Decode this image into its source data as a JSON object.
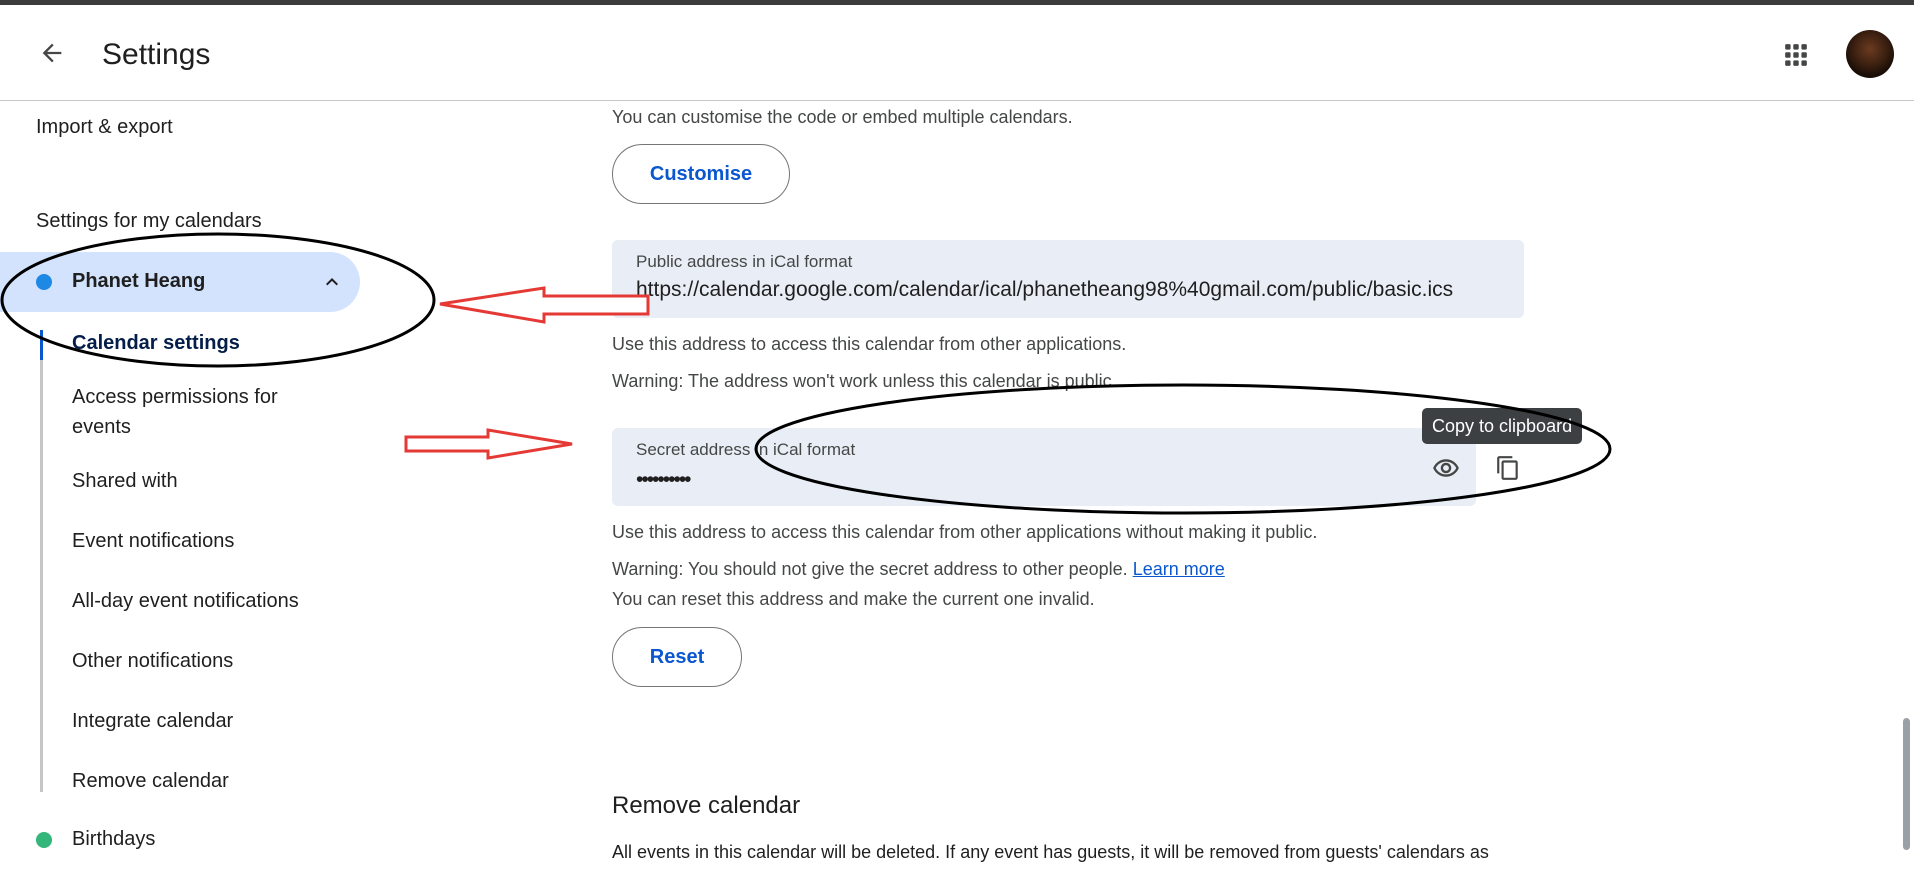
{
  "header": {
    "title": "Settings",
    "back_icon": "arrow-back-icon",
    "apps_icon": "apps-grid-icon"
  },
  "sidebar": {
    "import_export": "Import & export",
    "section_heading": "Settings for my calendars",
    "selected_calendar": {
      "name": "Phanet Heang",
      "color": "#1e88e5"
    },
    "sub_items": [
      "Calendar settings",
      "Access permissions for events",
      "Shared with",
      "Event notifications",
      "All-day event notifications",
      "Other notifications",
      "Integrate calendar",
      "Remove calendar"
    ],
    "other_calendar": {
      "name": "Birthdays",
      "color": "#33b679"
    }
  },
  "main": {
    "customise_hint": "You can customise the code or embed multiple calendars.",
    "customise_button": "Customise",
    "public_field": {
      "label": "Public address in iCal format",
      "value": "https://calendar.google.com/calendar/ical/phanetheang98%40gmail.com/public/basic.ics"
    },
    "public_help": "Use this address to access this calendar from other applications.",
    "public_warning": "Warning: The address won't work unless this calendar is public.",
    "secret_field": {
      "label": "Secret address in iCal format",
      "value": "••••••••••"
    },
    "tooltip": "Copy to clipboard",
    "secret_help": "Use this address to access this calendar from other applications without making it public.",
    "secret_warning": "Warning: You should not give the secret address to other people.",
    "learn_more": "Learn more",
    "reset_hint": "You can reset this address and make the current one invalid.",
    "reset_button": "Reset",
    "remove_title": "Remove calendar",
    "remove_desc": "All events in this calendar will be deleted. If any event has guests, it will be removed from guests' calendars as"
  },
  "colors": {
    "accent": "#0b57d0",
    "selected_bg": "#d3e3fd",
    "field_bg": "#e9eef6",
    "annotation_red": "#e53935"
  }
}
